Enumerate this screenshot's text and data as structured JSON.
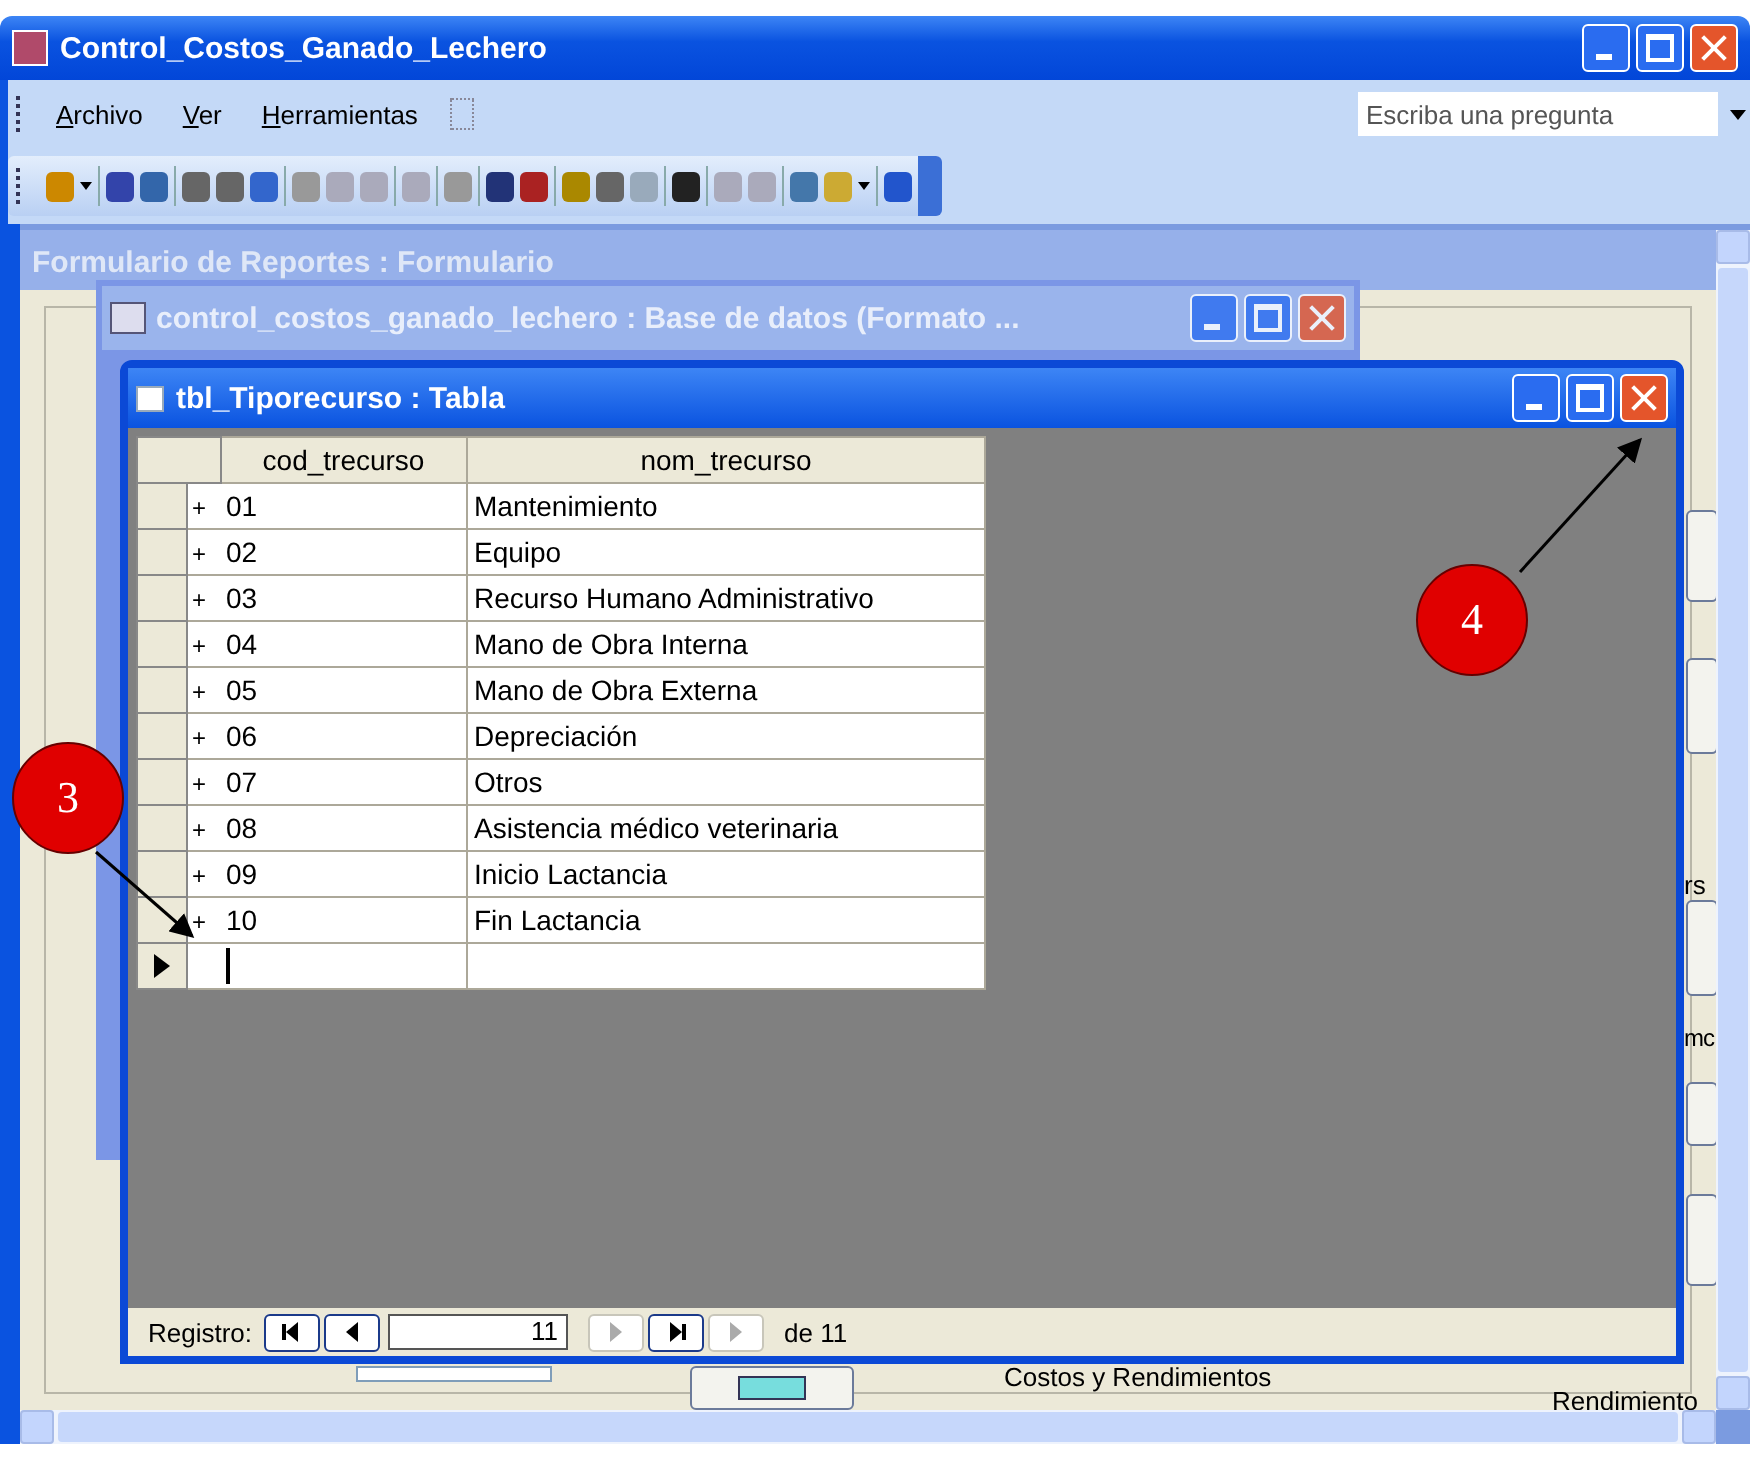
{
  "app": {
    "title": "Control_Costos_Ganado_Lechero"
  },
  "menu": [
    {
      "label": "Archivo"
    },
    {
      "label": "Ver"
    },
    {
      "label": "Herramientas"
    }
  ],
  "question_box": {
    "placeholder": "Escriba una pregunta"
  },
  "form_window": {
    "title": "Formulario  de  Reportes : Formulario",
    "labels": [
      {
        "text": "rs",
        "kind": "edge"
      },
      {
        "text": "mc",
        "kind": "edge"
      },
      {
        "text": "Costos y Rendimientos",
        "kind": "frame"
      },
      {
        "text": "Rendimiento",
        "kind": "bottom"
      }
    ]
  },
  "db_window": {
    "title": "control_costos_ganado_lechero : Base de datos (Formato ..."
  },
  "table_window": {
    "title": "tbl_Tiporecurso : Tabla",
    "columns": [
      "cod_trecurso",
      "nom_trecurso"
    ],
    "rows": [
      {
        "expander": "+",
        "cells": [
          "01",
          "Mantenimiento"
        ],
        "selected": false
      },
      {
        "expander": "+",
        "cells": [
          "02",
          "Equipo"
        ],
        "selected": false
      },
      {
        "expander": "+",
        "cells": [
          "03",
          "Recurso Humano Administrativo"
        ],
        "selected": false
      },
      {
        "expander": "+",
        "cells": [
          "04",
          "Mano de Obra Interna"
        ],
        "selected": false
      },
      {
        "expander": "+",
        "cells": [
          "05",
          "Mano de Obra Externa"
        ],
        "selected": false
      },
      {
        "expander": "+",
        "cells": [
          "06",
          "Depreciación"
        ],
        "selected": false
      },
      {
        "expander": "+",
        "cells": [
          "07",
          "Otros"
        ],
        "selected": false
      },
      {
        "expander": "+",
        "cells": [
          "08",
          "Asistencia médico veterinaria"
        ],
        "selected": false
      },
      {
        "expander": "+",
        "cells": [
          "09",
          "Inicio Lactancia"
        ],
        "selected": false
      },
      {
        "expander": "+",
        "cells": [
          "10",
          "Fin Lactancia"
        ],
        "selected": false
      }
    ],
    "new_record": {
      "selected": true
    },
    "navigator": {
      "label": "Registro:",
      "record": "11",
      "total": "de  11",
      "buttons": [
        {
          "kind": "first",
          "disabled": false
        },
        {
          "kind": "prev",
          "disabled": false
        },
        {
          "kind": "next",
          "disabled": true
        },
        {
          "kind": "last",
          "disabled": false
        },
        {
          "kind": "new",
          "disabled": true
        }
      ]
    }
  },
  "callouts": [
    {
      "number": "3"
    },
    {
      "number": "4"
    }
  ]
}
